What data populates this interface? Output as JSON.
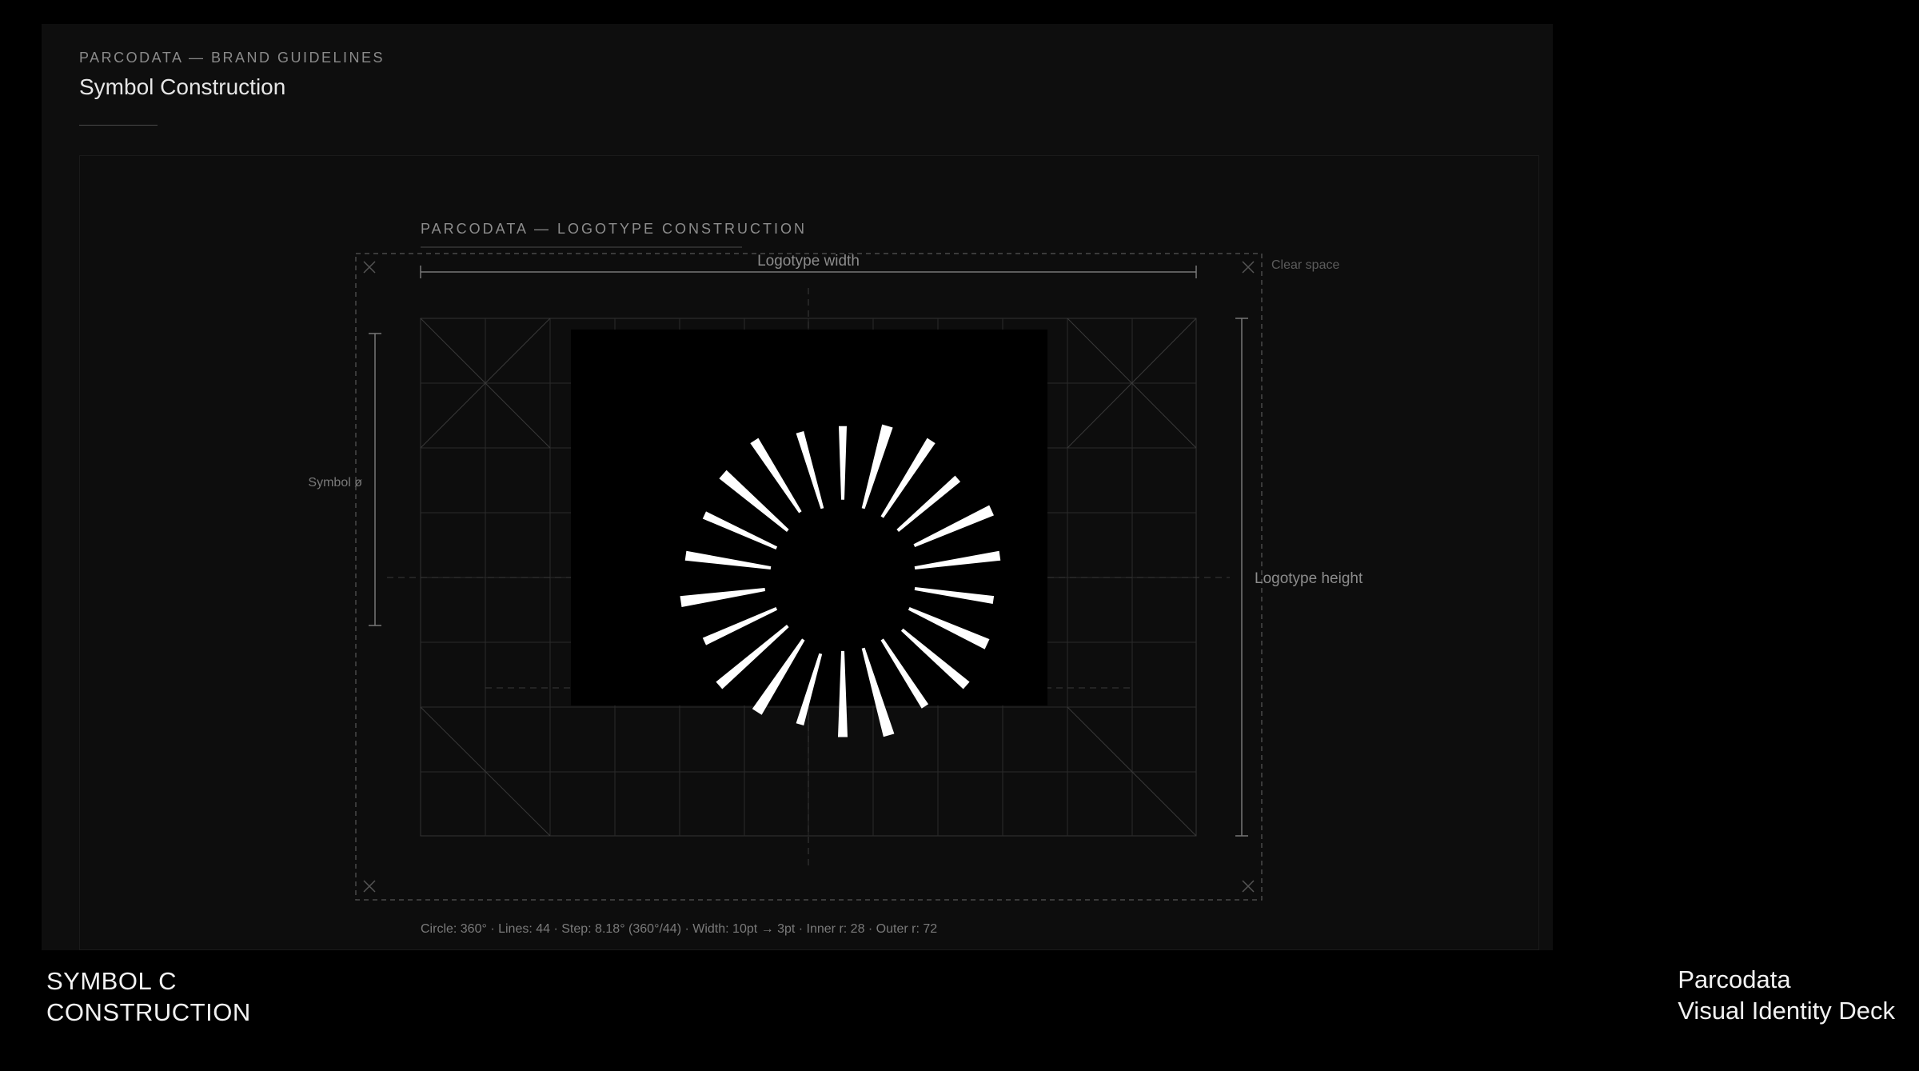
{
  "header": {
    "eyebrow": "PARCODATA — BRAND GUIDELINES",
    "title": "Symbol Construction"
  },
  "construction": {
    "heading": "PARCODATA — LOGOTYPE CONSTRUCTION",
    "width_label": "Logotype width",
    "height_label": "Logotype height",
    "symbol_label": "Symbol ø",
    "clear_space_label": "Clear space",
    "spec_line": "Circle: 360° · Lines: 44 · Step: 8.18° (360°/44) · Width: 10pt → 3pt · Inner r: 28 · Outer r: 72",
    "symbol": {
      "line_count": 44,
      "inner_radius": 28,
      "outer_radius": 72,
      "width_start_pt": 10,
      "width_end_pt": 3,
      "color": "#ffffff",
      "background": "#000000"
    }
  },
  "footer": {
    "left_line1": "SYMBOL C",
    "left_line2": "CONSTRUCTION",
    "right_line1": "Parcodata",
    "right_line2": "Visual Identity Deck"
  },
  "colors": {
    "page_bg": "#000000",
    "slide_bg": "#0e0e0e",
    "guide": "#3a3a3a",
    "label": "#8a8a8a",
    "text": "#f2f2f2"
  }
}
